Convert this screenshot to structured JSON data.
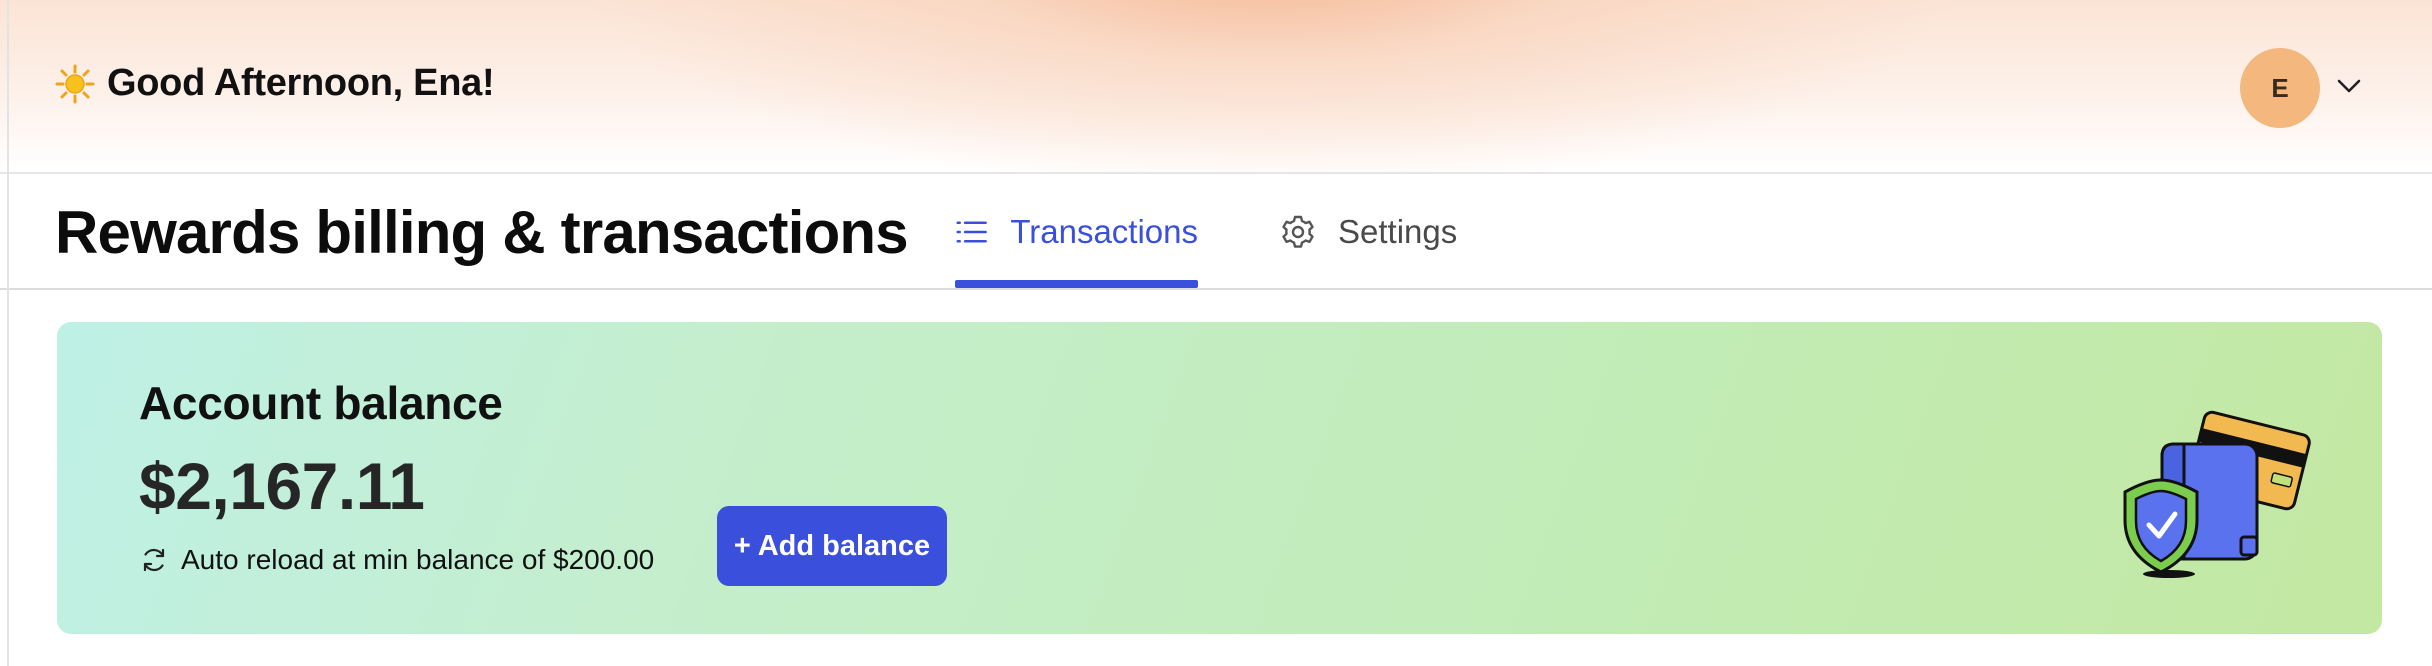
{
  "header": {
    "greeting": "Good Afternoon, Ena!",
    "greeting_icon": "sun-icon",
    "avatar_initial": "E",
    "avatar_color": "#f4b87e",
    "menu_icon": "chevron-down-icon"
  },
  "page": {
    "title": "Rewards billing & transactions",
    "tabs": [
      {
        "label": "Transactions",
        "icon": "list-icon",
        "active": true
      },
      {
        "label": "Settings",
        "icon": "gear-icon",
        "active": false
      }
    ],
    "accent_color": "#3a4fdc"
  },
  "balance_card": {
    "title": "Account balance",
    "amount": "$2,167.11",
    "auto_reload_text": "Auto reload at min balance of $200.00",
    "auto_reload_icon": "refresh-icon",
    "add_button_label": "+ Add balance",
    "illustration": "wallet-shield-illustration"
  }
}
